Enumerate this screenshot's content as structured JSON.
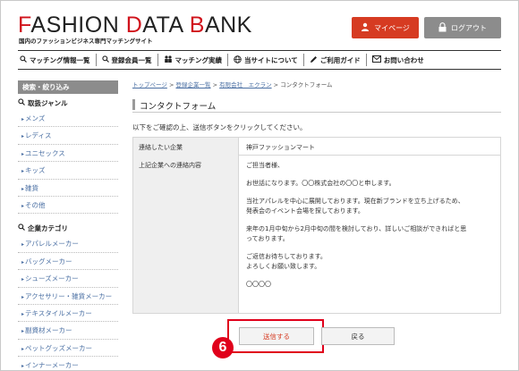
{
  "header": {
    "logo_part1": "F",
    "logo_part2": "ASHION ",
    "logo_part3": "D",
    "logo_part4": "ATA ",
    "logo_part5": "B",
    "logo_part6": "ANK",
    "tagline": "国内のファッションビジネス専門マッチングサイト",
    "mypage_label": "マイページ",
    "logout_label": "ログアウト",
    "accent_color": "#d63b22",
    "gray_button_color": "#8c8c8c"
  },
  "nav": {
    "items": [
      {
        "label": "マッチング情報一覧",
        "icon": "search-icon"
      },
      {
        "label": "登録会員一覧",
        "icon": "search-icon"
      },
      {
        "label": "マッチング実績",
        "icon": "people-icon"
      },
      {
        "label": "当サイトについて",
        "icon": "globe-icon"
      },
      {
        "label": "ご利用ガイド",
        "icon": "pen-icon"
      },
      {
        "label": "お問い合わせ",
        "icon": "mail-icon"
      }
    ]
  },
  "sidebar": {
    "heading": "検索・絞り込み",
    "genre_title": "取扱ジャンル",
    "genres": [
      "メンズ",
      "レディス",
      "ユニセックス",
      "キッズ",
      "雑貨",
      "その他"
    ],
    "category_title": "企業カテゴリ",
    "categories": [
      "アパレルメーカー",
      "バッグメーカー",
      "シューズメーカー",
      "アクセサリー・雑貨メーカー",
      "テキスタイルメーカー",
      "副資材メーカー",
      "ペットグッズメーカー",
      "インナーメーカー"
    ]
  },
  "breadcrumb": {
    "top": "トップページ",
    "members": "登録企業一覧",
    "company": "有限会社　エクラン",
    "current": "コンタクトフォーム",
    "separator": ">"
  },
  "page": {
    "title": "コンタクトフォーム",
    "instruction": "以下をご確認の上、送信ボタンをクリックしてください。"
  },
  "form": {
    "row1_label": "連絡したい企業",
    "row1_value": "神戸ファッションマート",
    "row2_label": "上記企業への連絡内容",
    "message": {
      "l1": "ご担当者様、",
      "l2": "お世話になります。〇〇株式会社の〇〇と申します。",
      "l3": "当社アパレルを中心に展開しております。現在新ブランドを立ち上げるため、",
      "l4": "発表会のイベント会場を探しております。",
      "l5": "来年の1月中旬から2月中旬の間を検討しており、詳しいご相談ができればと思",
      "l6": "っております。",
      "l7": "ご返信お待ちしております。",
      "l8": "よろしくお願い致します。",
      "l9": "〇〇〇〇"
    }
  },
  "actions": {
    "send_label": "送信する",
    "back_label": "戻る",
    "step_number": "6",
    "highlight_color": "#e0001b"
  }
}
